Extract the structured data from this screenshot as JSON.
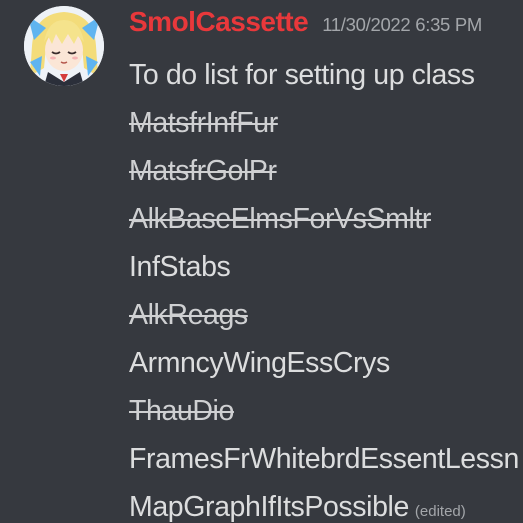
{
  "message": {
    "username": "SmolCassette",
    "timestamp": "11/30/2022 6:35 PM",
    "username_color": "#e8383b",
    "avatar": "anime-character-avatar",
    "lines": [
      {
        "text": "To do list for setting up class",
        "strikethrough": false
      },
      {
        "text": "MatsfrInfFur",
        "strikethrough": true
      },
      {
        "text": "MatsfrGolPr",
        "strikethrough": true
      },
      {
        "text": "AlkBaseElmsForVsSmltr",
        "strikethrough": true
      },
      {
        "text": "InfStabs",
        "strikethrough": false
      },
      {
        "text": "AlkReags",
        "strikethrough": true
      },
      {
        "text": "ArmncyWingEssCrys",
        "strikethrough": false
      },
      {
        "text": "ThauDio",
        "strikethrough": true
      },
      {
        "text": "FramesFrWhitebrdEssentLessn",
        "strikethrough": false
      },
      {
        "text": "MapGraphIfItsPossible",
        "strikethrough": false
      }
    ],
    "edited_label": "(edited)"
  }
}
